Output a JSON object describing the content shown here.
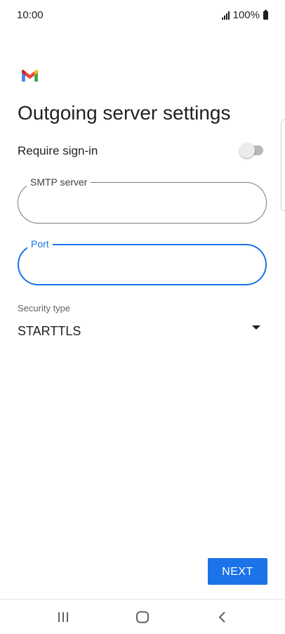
{
  "status_bar": {
    "time": "10:00",
    "battery": "100%",
    "icons": [
      "signal-icon",
      "battery-icon"
    ]
  },
  "app": {
    "logo": "gmail-logo",
    "colors": {
      "accent": "#1a73e8",
      "gmail_red": "#ea4335",
      "gmail_blue": "#4285f4",
      "gmail_green": "#34a853",
      "gmail_yellow": "#fbbc04"
    }
  },
  "page": {
    "title": "Outgoing server settings"
  },
  "signin": {
    "label": "Require sign-in",
    "enabled": false
  },
  "smtp_field": {
    "label": "SMTP server",
    "value": ""
  },
  "port_field": {
    "label": "Port",
    "value": "",
    "focused": true
  },
  "security": {
    "label": "Security type",
    "selected": "STARTTLS"
  },
  "actions": {
    "next_label": "NEXT"
  },
  "nav": {
    "icons": [
      "recents-icon",
      "home-icon",
      "back-icon"
    ]
  }
}
